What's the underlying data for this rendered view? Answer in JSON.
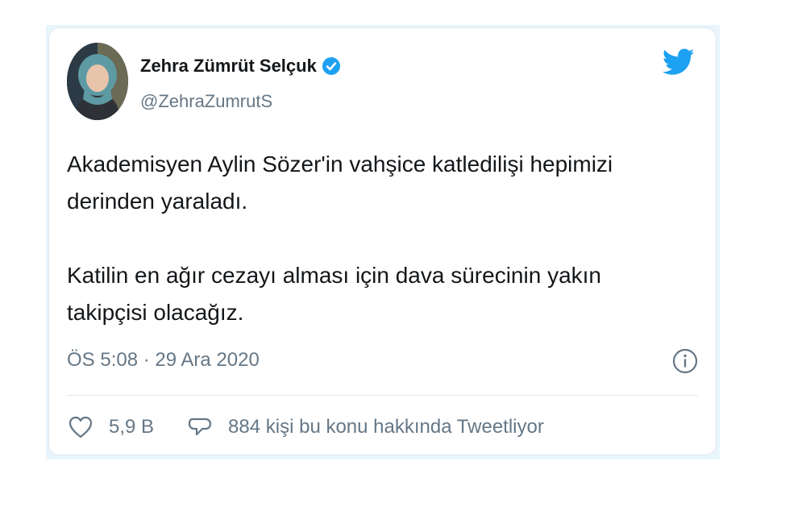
{
  "tweet": {
    "author_name": "Zehra Zümrüt Selçuk",
    "handle": "@ZehraZumrutS",
    "text": "Akademisyen Aylin Sözer'in vahşice katledilişi hepimizi\nderinden yaraladı.\n\nKatilin en ağır cezayı alması için dava sürecinin yakın\ntakipçisi olacağız.",
    "timestamp": "ÖS 5:08 · 29 Ara 2020",
    "likes": "5,9 B",
    "replies_text": "884 kişi bu konu hakkında Tweetliyor"
  },
  "icons": {
    "verified": "verified-badge-icon",
    "logo": "twitter-bird-icon",
    "info": "info-icon",
    "like": "heart-icon",
    "reply": "speech-bubble-icon"
  },
  "colors": {
    "brand": "#1da1f2",
    "text": "#14171a",
    "muted": "#657786",
    "border": "#e1e8ed"
  }
}
